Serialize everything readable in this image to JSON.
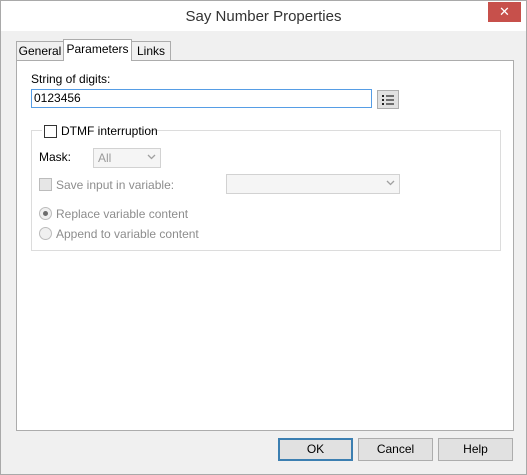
{
  "window": {
    "title": "Say Number Properties",
    "close_glyph": "✕"
  },
  "tabs": [
    {
      "label": "General",
      "active": false
    },
    {
      "label": "Parameters",
      "active": true
    },
    {
      "label": "Links",
      "active": false
    }
  ],
  "parameters": {
    "string_label": "String of digits:",
    "string_value": "0123456",
    "dtmf": {
      "label": "DTMF interruption",
      "checked": false,
      "mask_label": "Mask:",
      "mask_value": "All",
      "save_label": "Save input in variable:",
      "save_checked": false,
      "save_variable_value": "",
      "replace_label": "Replace variable content",
      "replace_selected": true,
      "append_label": "Append to variable content",
      "append_selected": false
    }
  },
  "buttons": {
    "ok": "OK",
    "cancel": "Cancel",
    "help": "Help"
  },
  "icons": {
    "close": "close-icon",
    "variables": "variable-list-icon",
    "dropdown": "chevron-down-icon"
  },
  "colors": {
    "close_button": "#c7504b",
    "focus_border": "#569de5",
    "default_button_border": "#3c7fb1"
  }
}
